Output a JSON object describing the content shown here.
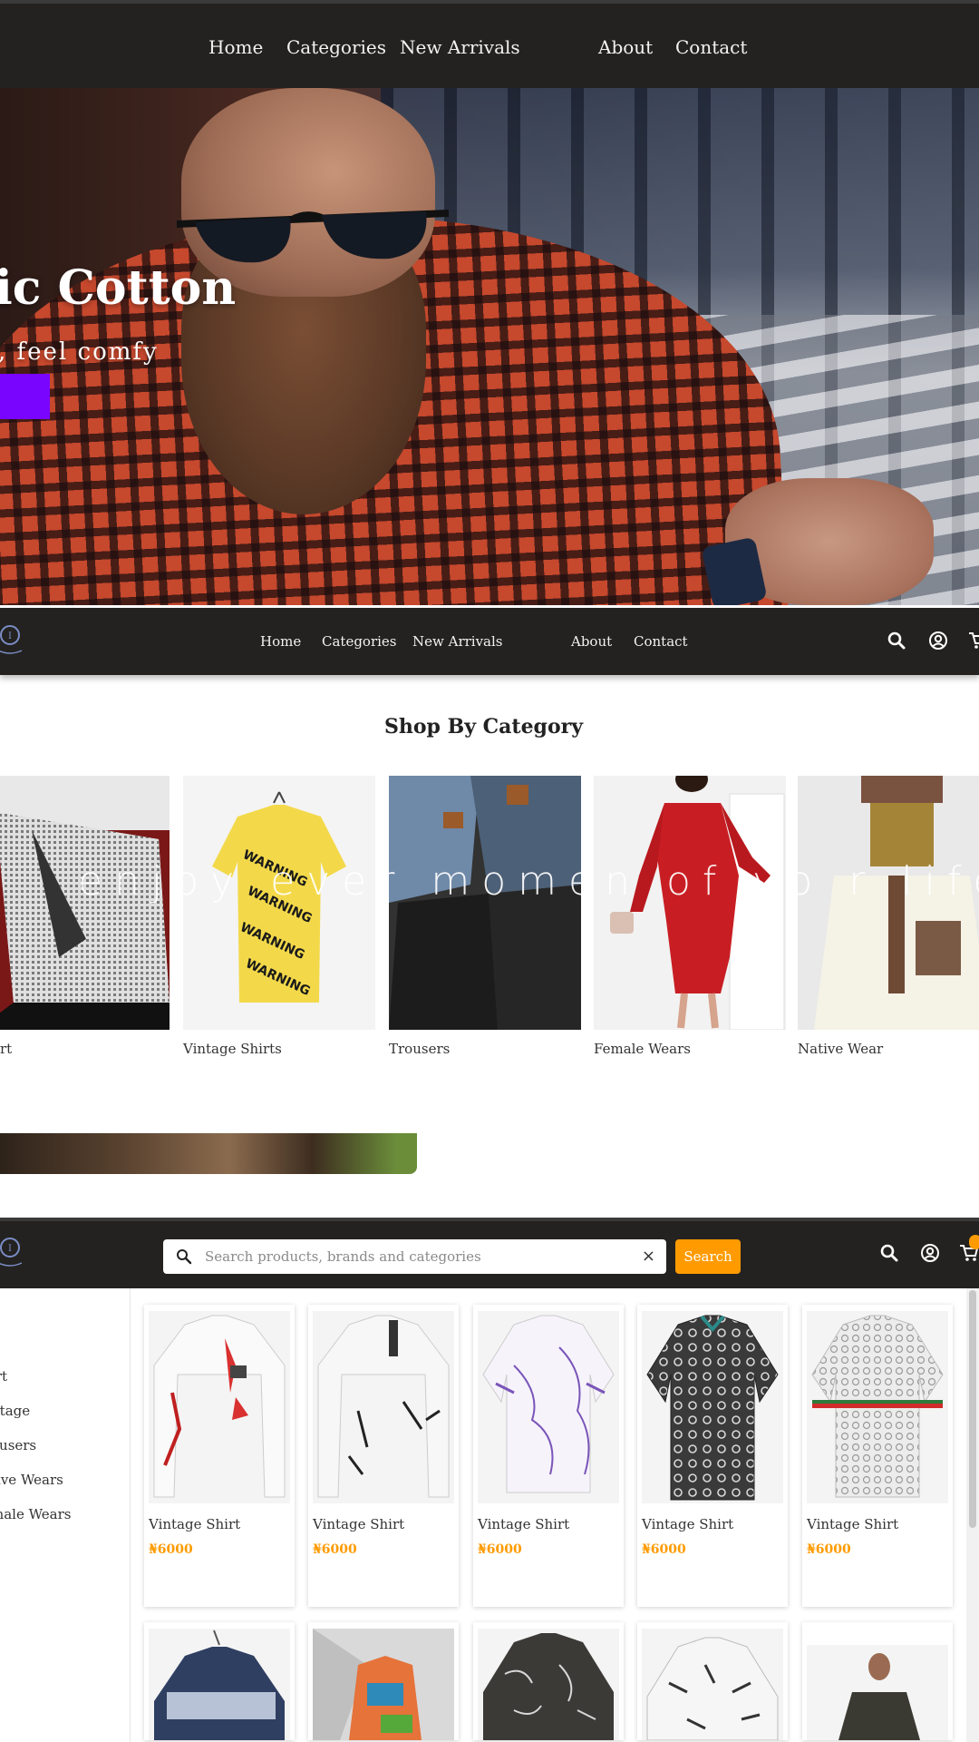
{
  "top_nav": {
    "links": [
      "Home",
      "Categories",
      "New Arrivals",
      "About",
      "Contact"
    ]
  },
  "hero": {
    "title": "ic Cotton",
    "subtitle": ", feel comfy"
  },
  "sticky_nav": {
    "links": [
      "Home",
      "Categories",
      "New Arrivals",
      "About",
      "Contact"
    ],
    "icons": [
      "search-icon",
      "user-icon",
      "cart-icon"
    ]
  },
  "categories": {
    "title": "Shop By Category",
    "overlay_text": "enjoy ever  momen  of yo r life",
    "items": [
      {
        "label": "rt"
      },
      {
        "label": "Vintage Shirts"
      },
      {
        "label": "Trousers"
      },
      {
        "label": "Female Wears"
      },
      {
        "label": "Native Wear"
      }
    ]
  },
  "search_header": {
    "search": {
      "placeholder": "Search products, brands and categories",
      "clear_glyph": "×",
      "button_label": "Search"
    },
    "icons": [
      "search-icon",
      "user-icon",
      "cart-icon"
    ]
  },
  "sidebar": {
    "items": [
      "irt",
      "ntage",
      "ousers",
      "tive Wears",
      "male Wears"
    ]
  },
  "products": [
    {
      "name": "Vintage Shirt",
      "price": "₦6000"
    },
    {
      "name": "Vintage Shirt",
      "price": "₦6000"
    },
    {
      "name": "Vintage Shirt",
      "price": "₦6000"
    },
    {
      "name": "Vintage Shirt",
      "price": "₦6000"
    },
    {
      "name": "Vintage Shirt",
      "price": "₦6000"
    }
  ],
  "colors": {
    "nav_bg": "#232220",
    "accent": "#ff9b00",
    "cta": "#7a05ff"
  }
}
